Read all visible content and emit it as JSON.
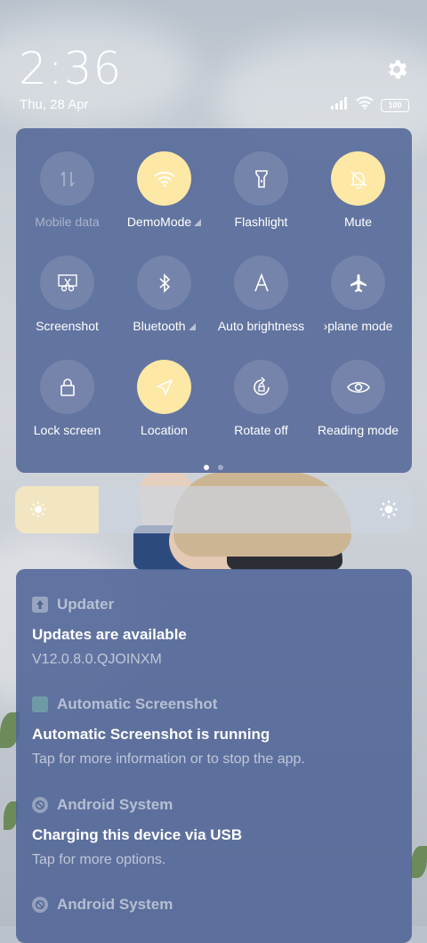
{
  "status": {
    "time": "2:36",
    "date": "Thu, 28 Apr",
    "battery": "100"
  },
  "quick_settings": [
    {
      "label": "Mobile data",
      "state": "disabled",
      "icon": "mobile-data-icon",
      "expandable": false
    },
    {
      "label": "DemoMode",
      "state": "on",
      "icon": "wifi-icon",
      "expandable": true
    },
    {
      "label": "Flashlight",
      "state": "off",
      "icon": "flashlight-icon",
      "expandable": false
    },
    {
      "label": "Mute",
      "state": "on",
      "icon": "bell-off-icon",
      "expandable": false
    },
    {
      "label": "Screenshot",
      "state": "off",
      "icon": "scissors-icon",
      "expandable": false
    },
    {
      "label": "Bluetooth",
      "state": "off",
      "icon": "bluetooth-icon",
      "expandable": true
    },
    {
      "label": "Auto brightness",
      "state": "off",
      "icon": "auto-brightness-icon",
      "expandable": false
    },
    {
      "label": "›plane mode",
      "state": "off",
      "icon": "airplane-icon",
      "expandable": false
    },
    {
      "label": "Lock screen",
      "state": "off",
      "icon": "lock-icon",
      "expandable": false
    },
    {
      "label": "Location",
      "state": "on",
      "icon": "location-icon",
      "expandable": false
    },
    {
      "label": "Rotate off",
      "state": "off",
      "icon": "rotate-lock-icon",
      "expandable": false
    },
    {
      "label": "Reading mode",
      "state": "off",
      "icon": "eye-icon",
      "expandable": false
    }
  ],
  "pager": {
    "pages": 2,
    "current": 1
  },
  "brightness": {
    "level": 0.21
  },
  "notifications": [
    {
      "app": "Updater",
      "title": "Updates are available",
      "text": "V12.0.8.0.QJOINXM",
      "icon": "updater-icon"
    },
    {
      "app": "Automatic Screenshot",
      "title": "Automatic Screenshot is running",
      "text": "Tap for more information or to stop the app.",
      "icon": "app-square-icon"
    },
    {
      "app": "Android System",
      "title": "Charging this device via USB",
      "text": "Tap for more options.",
      "icon": "android-system-icon"
    },
    {
      "app": "Android System",
      "title": "",
      "text": "",
      "icon": "android-system-icon"
    }
  ],
  "colors": {
    "panel": "#50648f",
    "tile_on": "#fde8a6",
    "brightness_fill": "#f2e6c2"
  }
}
